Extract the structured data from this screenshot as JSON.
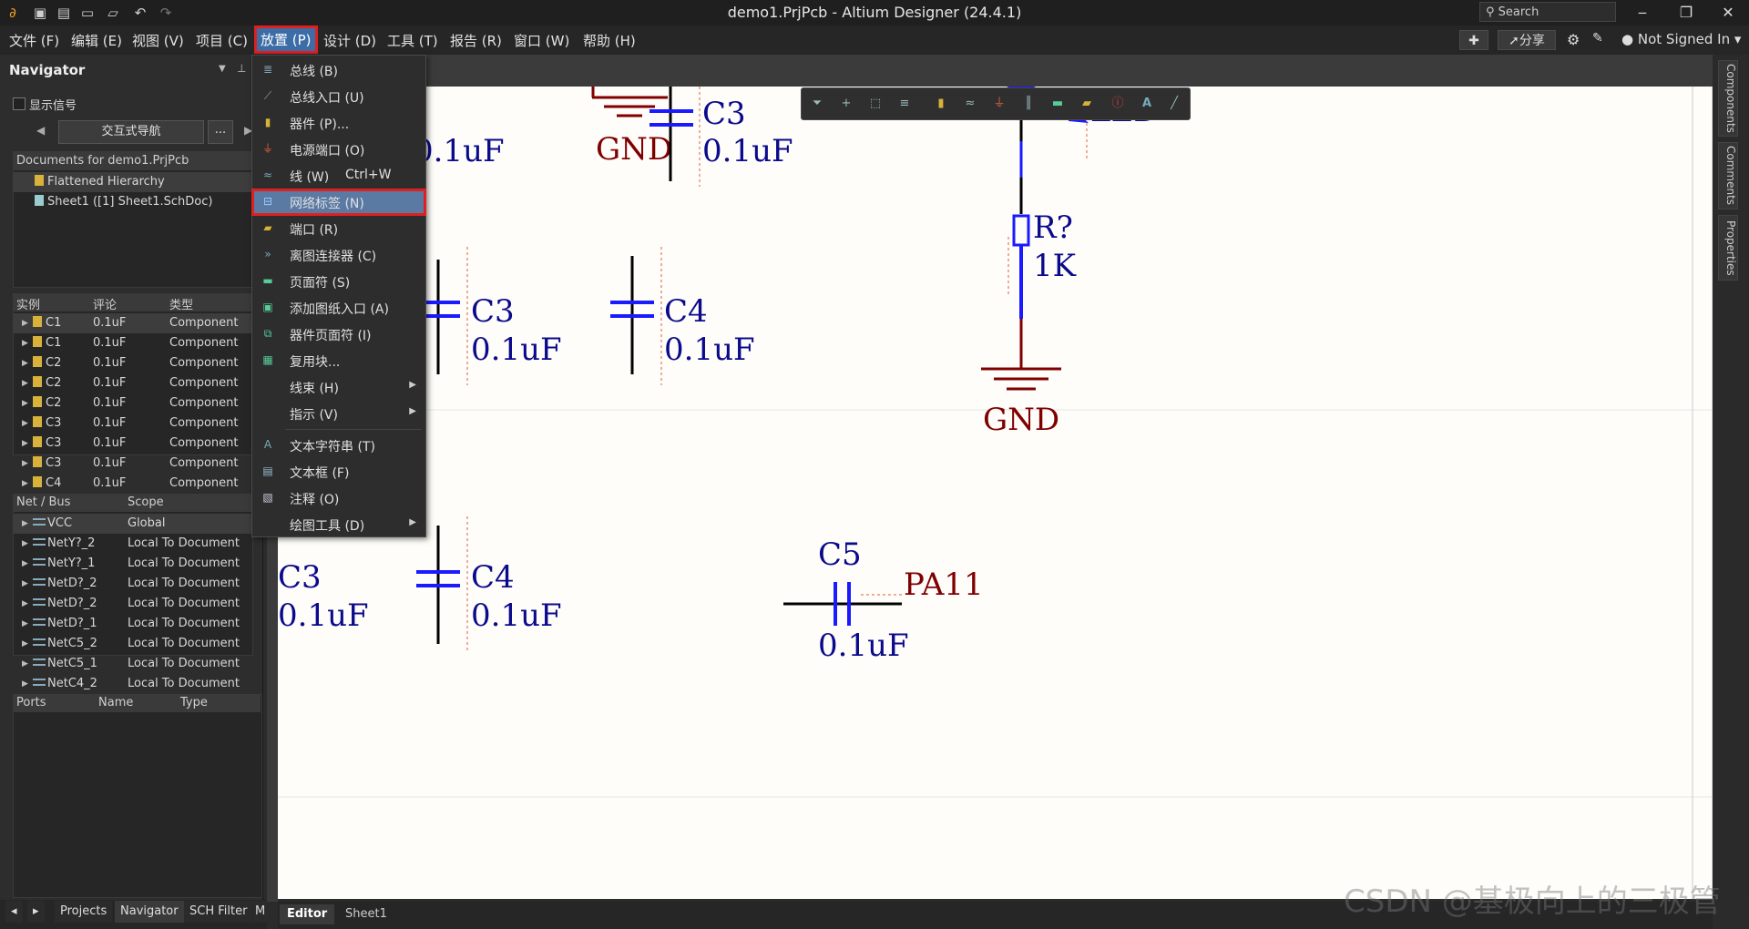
{
  "window": {
    "title": "demo1.PrjPcb - Altium Designer (24.4.1)",
    "search_placeholder": "Search"
  },
  "menubar": {
    "items": [
      "文件 (F)",
      "编辑 (E)",
      "视图 (V)",
      "项目 (C)",
      "放置 (P)",
      "设计 (D)",
      "工具 (T)",
      "报告 (R)",
      "窗口 (W)",
      "帮助 (H)"
    ],
    "share_label": "分享",
    "user_label": "Not Signed In"
  },
  "navigator": {
    "title": "Navigator",
    "show_signals": "显示信号",
    "interactive_nav": "交互式导航",
    "more_btn": "...",
    "docs_header": "Documents for demo1.PrjPcb",
    "docs": [
      "Flattened Hierarchy",
      "Sheet1 ([1] Sheet1.SchDoc)"
    ],
    "instance_headers": [
      "实例",
      "评论",
      "类型"
    ],
    "instances": [
      {
        "name": "C1",
        "comment": "0.1uF",
        "type": "Component"
      },
      {
        "name": "C1",
        "comment": "0.1uF",
        "type": "Component"
      },
      {
        "name": "C2",
        "comment": "0.1uF",
        "type": "Component"
      },
      {
        "name": "C2",
        "comment": "0.1uF",
        "type": "Component"
      },
      {
        "name": "C2",
        "comment": "0.1uF",
        "type": "Component"
      },
      {
        "name": "C3",
        "comment": "0.1uF",
        "type": "Component"
      },
      {
        "name": "C3",
        "comment": "0.1uF",
        "type": "Component"
      },
      {
        "name": "C3",
        "comment": "0.1uF",
        "type": "Component"
      },
      {
        "name": "C4",
        "comment": "0.1uF",
        "type": "Component"
      }
    ],
    "net_headers": [
      "Net / Bus",
      "Scope"
    ],
    "nets": [
      {
        "name": "VCC",
        "scope": "Global"
      },
      {
        "name": "NetY?_2",
        "scope": "Local To Document"
      },
      {
        "name": "NetY?_1",
        "scope": "Local To Document"
      },
      {
        "name": "NetD?_2",
        "scope": "Local To Document"
      },
      {
        "name": "NetD?_2",
        "scope": "Local To Document"
      },
      {
        "name": "NetD?_1",
        "scope": "Local To Document"
      },
      {
        "name": "NetC5_2",
        "scope": "Local To Document"
      },
      {
        "name": "NetC5_1",
        "scope": "Local To Document"
      },
      {
        "name": "NetC4_2",
        "scope": "Local To Document"
      }
    ],
    "port_headers": [
      "Ports",
      "Name",
      "Type"
    ],
    "bottom_tabs": [
      "Projects",
      "Navigator",
      "SCH Filter",
      "M"
    ]
  },
  "place_menu": {
    "items": [
      {
        "label": "总线 (B)",
        "icon": "bus-icon"
      },
      {
        "label": "总线入口 (U)",
        "icon": "bus-entry-icon"
      },
      {
        "label": "器件 (P)...",
        "icon": "part-icon"
      },
      {
        "label": "电源端口 (O)",
        "icon": "power-port-icon"
      },
      {
        "label": "线 (W)",
        "shortcut": "Ctrl+W",
        "icon": "wire-icon"
      },
      {
        "label": "网络标签 (N)",
        "icon": "net-label-icon",
        "highlighted": true
      },
      {
        "label": "端口 (R)",
        "icon": "port-icon"
      },
      {
        "label": "离图连接器 (C)",
        "icon": "off-sheet-connector-icon"
      },
      {
        "label": "页面符 (S)",
        "icon": "sheet-symbol-icon"
      },
      {
        "label": "添加图纸入口 (A)",
        "icon": "sheet-entry-icon"
      },
      {
        "label": "器件页面符 (I)",
        "icon": "device-sheet-icon"
      },
      {
        "label": "复用块...",
        "icon": "reuse-block-icon"
      },
      {
        "label": "线束 (H)",
        "icon": "",
        "submenu": true
      },
      {
        "label": "指示 (V)",
        "icon": "",
        "submenu": true
      },
      {
        "label": "文本字符串 (T)",
        "icon": "text-string-icon"
      },
      {
        "label": "文本框 (F)",
        "icon": "text-frame-icon"
      },
      {
        "label": "注释 (O)",
        "icon": "note-icon"
      },
      {
        "label": "绘图工具 (D)",
        "icon": "",
        "submenu": true
      }
    ]
  },
  "right_panels": [
    "Components",
    "Comments",
    "Properties"
  ],
  "editor_tabs": [
    "Editor",
    "Sheet1"
  ],
  "schematic": {
    "labels": {
      "c3_top": "C3",
      "c3_top_val": "0.1uF",
      "gnd_top": "GND",
      "left_partial_val": "uF",
      "c3_mid": "C3",
      "c3_mid_val": "0.1uF",
      "c4_mid": "C4",
      "c4_mid_val": "0.1uF",
      "r_ref": "R?",
      "r_val": "1K",
      "gnd_right": "GND",
      "c3_low": "C3",
      "c3_low_val": "0.1uF",
      "c4_low": "C4",
      "c4_low_val": "0.1uF",
      "c5": "C5",
      "c5_val": "0.1uF",
      "net_label": "PA11",
      "led_partial": "LED"
    }
  },
  "watermark": "CSDN @基极向上的三极管",
  "colors": {
    "accent_red": "#e02020",
    "menu_highlight": "#5a79a3",
    "schematic_blue": "#0a0a8c",
    "wire_blue": "#1a1aff",
    "gnd_red": "#800000"
  }
}
